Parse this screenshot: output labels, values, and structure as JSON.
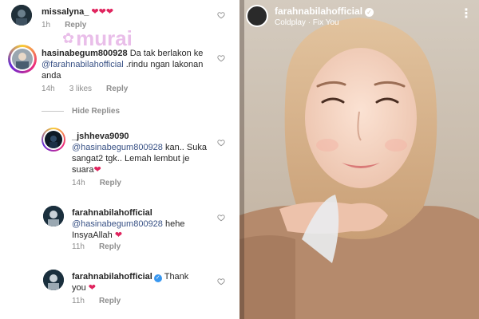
{
  "watermark": {
    "text": "murai"
  },
  "comments": [
    {
      "username": "missalyna_",
      "text": "❤❤❤",
      "time": "1h",
      "reply": "Reply"
    },
    {
      "username": "hasinabegum800928",
      "text_a": "Da tak berlakon ke ",
      "mention": "@farahnabilahofficial",
      "text_b": " .rindu ngan lakonan anda",
      "time": "14h",
      "likes": "3 likes",
      "reply": "Reply"
    }
  ],
  "hide_replies": "Hide Replies",
  "replies": [
    {
      "username": "_jshheva9090",
      "mention": "@hasinabegum800928",
      "text": " kan.. Suka sangat2 tgk.. Lemah lembut je suara",
      "heart": "❤",
      "time": "14h",
      "reply": "Reply"
    },
    {
      "username": "farahnabilahofficial",
      "mention": "@hasinabegum800928",
      "text": " hehe InsyaAllah ",
      "heart": "❤",
      "time": "11h",
      "reply": "Reply"
    },
    {
      "username": "farahnabilahofficial",
      "text": "Thank you ",
      "heart": "❤",
      "time": "11h",
      "reply": "Reply"
    }
  ],
  "story": {
    "username": "farahnabilahofficial",
    "music": "Coldplay · Fix You",
    "more": "⋮"
  },
  "colors": {
    "heart": "#e0245e",
    "mention": "#385185",
    "verified": "#3897f0",
    "meta": "#8e8e8e"
  },
  "icons": [
    "heart-outline-icon",
    "verified-icon",
    "more-vert-icon",
    "flower-icon"
  ]
}
